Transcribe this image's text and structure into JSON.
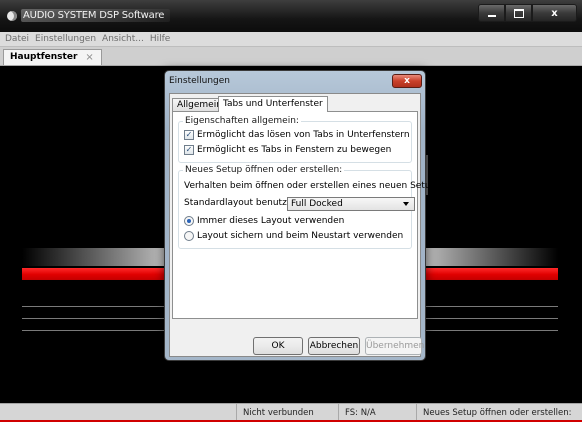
{
  "window": {
    "title": "AUDIO SYSTEM DSP Software"
  },
  "menu": [
    "Datei",
    "Einstellungen",
    "Ansicht...",
    "Hilfe"
  ],
  "doc_tab": {
    "label": "Hauptfenster",
    "close": "×"
  },
  "dialog": {
    "title": "Einstellungen",
    "close": "x",
    "tabs": [
      "Allgemein",
      "Tabs und Unterfenster"
    ],
    "group1": {
      "legend": "Eigenschaften allgemein:",
      "options": [
        {
          "label": "Ermöglicht das lösen von Tabs in Unterfenstern",
          "checked": true
        },
        {
          "label": "Ermöglicht es Tabs in Fenstern zu bewegen",
          "checked": true
        }
      ]
    },
    "group2": {
      "legend": "Neues Setup öffnen oder erstellen:",
      "description": "Verhalten beim öffnen oder erstellen eines neuen Setups:",
      "layout_label": "Standardlayout benutzen:",
      "layout_value": "Full Docked",
      "radios": [
        {
          "label": "Immer dieses Layout verwenden",
          "selected": true
        },
        {
          "label": "Layout sichern und beim Neustart verwenden",
          "selected": false
        }
      ]
    },
    "buttons": {
      "ok": "OK",
      "cancel": "Abbrechen",
      "apply": "Übernehmen"
    }
  },
  "status": {
    "connection": "Nicht verbunden",
    "fs": "FS: N/A",
    "message": "Neues Setup öffnen oder erstellen:"
  },
  "colors": {
    "accent_red": "#e00000",
    "background": "#000000"
  }
}
